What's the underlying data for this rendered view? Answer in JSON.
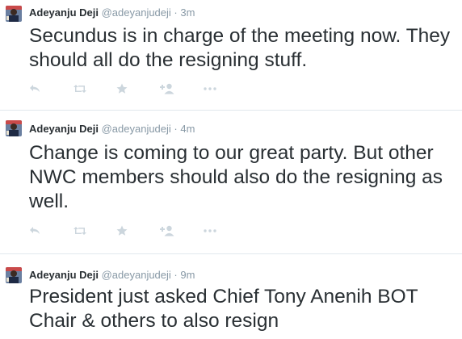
{
  "tweets": [
    {
      "name": "Adeyanju Deji",
      "handle": "@adeyanjudeji",
      "separator": "·",
      "time": "3m",
      "text": "Secundus is in charge of the meeting now. They should all do the resigning stuff."
    },
    {
      "name": "Adeyanju Deji",
      "handle": "@adeyanjudeji",
      "separator": "·",
      "time": "4m",
      "text": "Change is coming to our great party. But other NWC members should also do the resigning as well."
    },
    {
      "name": "Adeyanju Deji",
      "handle": "@adeyanjudeji",
      "separator": "·",
      "time": "9m",
      "text": "President just asked Chief Tony Anenih BOT Chair  & others to also resign"
    }
  ],
  "actions": {
    "icons": [
      "reply-icon",
      "retweet-icon",
      "favorite-icon",
      "follow-icon",
      "more-icon"
    ],
    "color": "#ccd6dd"
  },
  "colors": {
    "text": "#292f33",
    "meta": "#8899a6",
    "divider": "#e1e8ed"
  }
}
